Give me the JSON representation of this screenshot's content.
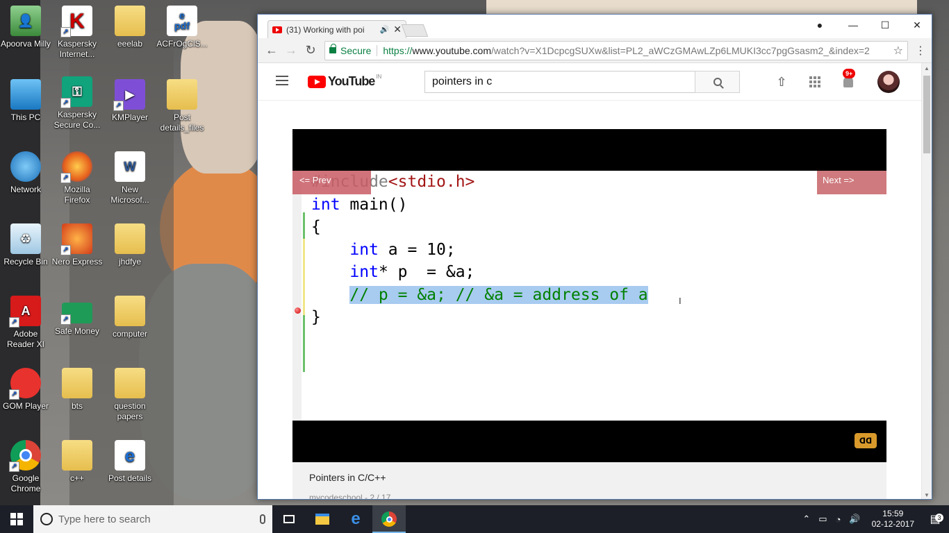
{
  "desktop": {
    "icons": [
      {
        "label": "Apoorva Milly"
      },
      {
        "label": "Kaspersky Internet..."
      },
      {
        "label": "eeelab"
      },
      {
        "label": "ACFrOgClS..."
      },
      {
        "label": "This PC"
      },
      {
        "label": "Kaspersky Secure Co..."
      },
      {
        "label": "KMPlayer"
      },
      {
        "label": "Post details_files"
      },
      {
        "label": "Network"
      },
      {
        "label": "Mozilla Firefox"
      },
      {
        "label": "New Microsof..."
      },
      {
        "label": "Recycle Bin"
      },
      {
        "label": "Nero Express"
      },
      {
        "label": "jhdfye"
      },
      {
        "label": "Adobe Reader XI"
      },
      {
        "label": "Safe Money"
      },
      {
        "label": "computer"
      },
      {
        "label": "GOM Player"
      },
      {
        "label": "bts"
      },
      {
        "label": "question papers"
      },
      {
        "label": "Google Chrome"
      },
      {
        "label": "c++"
      },
      {
        "label": "Post details"
      }
    ]
  },
  "browser": {
    "tab_title": "(31) Working with poi",
    "url_secure_label": "Secure",
    "url_scheme": "https://",
    "url_host": "www.youtube.com",
    "url_rest": "/watch?v=X1DcpcgSUXw&list=PL2_aWCzGMAwLZp6LMUKI3cc7pgGsasm2_&index=2"
  },
  "youtube": {
    "logo_text": "YouTube",
    "country_code": "IN",
    "search_value": "pointers in c",
    "notifications_badge": "9+",
    "player": {
      "prev_label": "<= Prev",
      "next_label": "Next =>",
      "code": {
        "line1_directive": "#include",
        "line1_header": "<stdio.h>",
        "line2_kw": "int",
        "line2_rest": " main()",
        "line3": "{",
        "line4_kw": "int",
        "line4_rest": " a = 10;",
        "line5_kw": "int",
        "line5_rest": "* p  = &a;",
        "line6_comment": "// p = &a; // &a = address of a",
        "line7": "}"
      }
    },
    "playlist_title": "Pointers in C/C++",
    "playlist_subtitle": "mycodeschool - 2 / 17"
  },
  "taskbar": {
    "search_placeholder": "Type here to search",
    "time": "15:59",
    "date": "02-12-2017",
    "notification_count": "3"
  }
}
